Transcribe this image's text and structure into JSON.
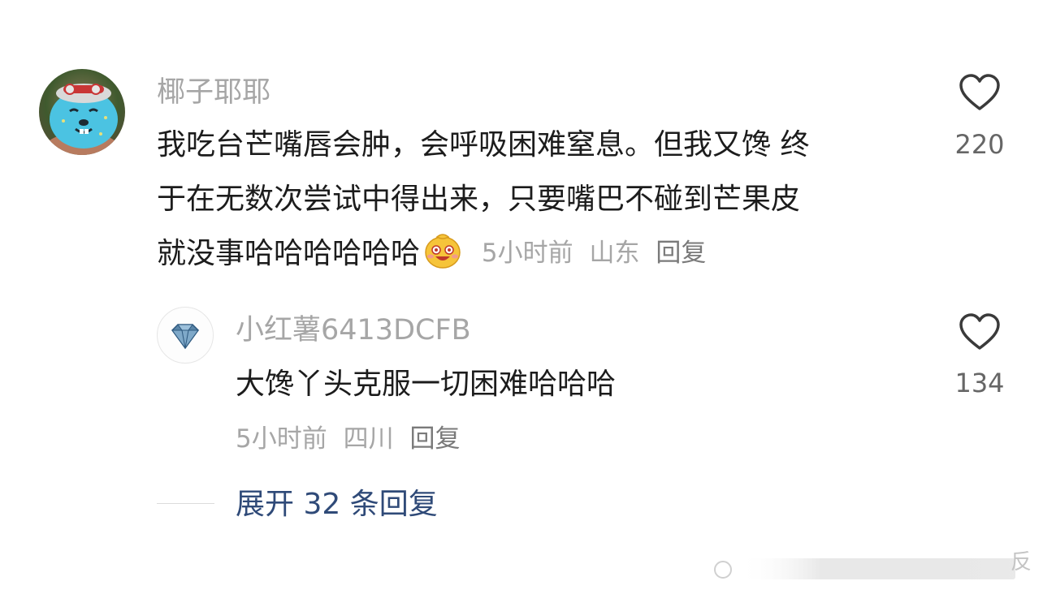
{
  "comment": {
    "username": "椰子耶耶",
    "lines": [
      "我吃台芒嘴唇会肿，会呼吸困难窒息。但我又馋 终",
      "于在无数次尝试中得出来，只要嘴巴不碰到芒果皮",
      "就没事哈哈哈哈哈哈"
    ],
    "emoji": "smiling-face-emoji",
    "time": "5小时前",
    "location": "山东",
    "reply_label": "回复",
    "like_count": "220"
  },
  "reply": {
    "username": "小红薯6413DCFB",
    "text": "大馋丫头克服一切困难哈哈哈",
    "time": "5小时前",
    "location": "四川",
    "reply_label": "回复",
    "like_count": "134",
    "avatar_icon": "diamond-icon"
  },
  "expand": {
    "label": "展开 32 条回复"
  },
  "watermark": {
    "text_partial": "反"
  },
  "colors": {
    "username": "#a6a6a6",
    "text": "#1c1c1c",
    "meta": "#a6a6a6",
    "link": "#2f4a78",
    "heart_stroke": "#3a3a3a"
  }
}
